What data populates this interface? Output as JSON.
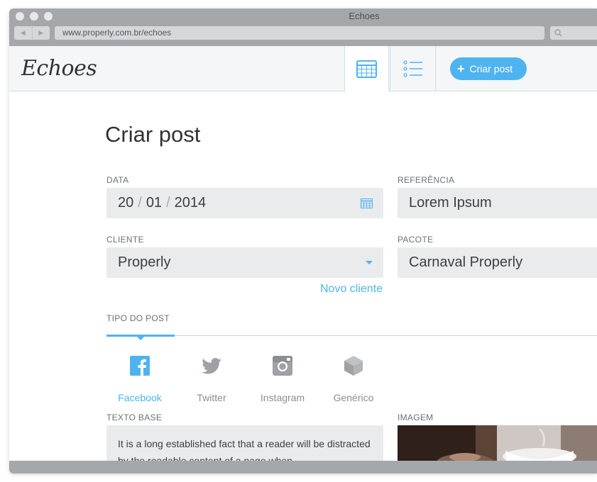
{
  "window": {
    "title": "Echoes",
    "url": "www.properly.com.br/echoes"
  },
  "app": {
    "logo": "Echoes",
    "create_button": "Criar post",
    "create_icon": "plus-icon"
  },
  "nav": [
    {
      "icon": "calendar-icon",
      "active": true
    },
    {
      "icon": "list-icon",
      "active": false
    }
  ],
  "form": {
    "title": "Criar post",
    "data": {
      "label": "DATA",
      "day": "20",
      "month": "01",
      "year": "2014",
      "sep": "/"
    },
    "referencia": {
      "label": "REFERÊNCIA",
      "value": "Lorem Ipsum"
    },
    "cliente": {
      "label": "CLIENTE",
      "value": "Properly",
      "new_link": "Novo cliente"
    },
    "pacote": {
      "label": "PACOTE",
      "value": "Carnaval Properly"
    },
    "tipo": {
      "label": "TIPO DO POST",
      "options": [
        {
          "name": "Facebook",
          "icon": "facebook-icon",
          "selected": true
        },
        {
          "name": "Twitter",
          "icon": "twitter-icon",
          "selected": false
        },
        {
          "name": "Instagram",
          "icon": "instagram-icon",
          "selected": false
        },
        {
          "name": "Genérico",
          "icon": "cube-icon",
          "selected": false
        }
      ]
    },
    "texto_base": {
      "label": "TEXTO BASE",
      "value": "It is a long established fact that a reader will be distracted by the readable content of a page when"
    },
    "imagem": {
      "label": "IMAGEM"
    }
  },
  "colors": {
    "accent": "#4fb3f0",
    "field_bg": "#e9ebec",
    "chrome": "#a5a8ab"
  }
}
